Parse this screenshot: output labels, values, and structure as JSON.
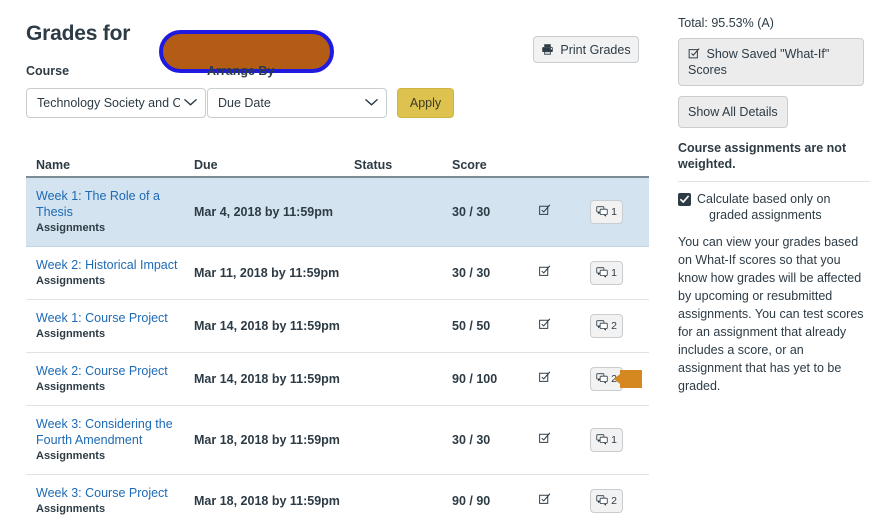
{
  "header": {
    "title": "Grades for",
    "redacted_name": "",
    "print_button": "Print Grades",
    "print_icon": "printer-icon"
  },
  "filters": {
    "course_label": "Course",
    "course_value": "Technology Society and Cu",
    "arrange_label": "Arrange By",
    "arrange_value": "Due Date",
    "apply_label": "Apply",
    "caret_icon": "chevron-down-icon"
  },
  "table": {
    "columns": [
      "Name",
      "Due",
      "Status",
      "Score",
      "",
      ""
    ],
    "rows": [
      {
        "name": "Week 1: The Role of a Thesis",
        "group": "Assignments",
        "due": "Mar 4, 2018 by 11:59pm",
        "status": "",
        "score": "30 / 30",
        "whatif_icon": "what-if-score-icon",
        "comment_icon": "comment-icon",
        "comment_count": "1",
        "highlighted": true,
        "marker": false
      },
      {
        "name": "Week 2: Historical Impact",
        "group": "Assignments",
        "due": "Mar 11, 2018 by 11:59pm",
        "status": "",
        "score": "30 / 30",
        "whatif_icon": "what-if-score-icon",
        "comment_icon": "comment-icon",
        "comment_count": "1",
        "highlighted": false,
        "marker": false
      },
      {
        "name": "Week 1: Course Project",
        "group": "Assignments",
        "due": "Mar 14, 2018 by 11:59pm",
        "status": "",
        "score": "50 / 50",
        "whatif_icon": "what-if-score-icon",
        "comment_icon": "comment-icon",
        "comment_count": "2",
        "highlighted": false,
        "marker": false
      },
      {
        "name": "Week 2: Course Project",
        "group": "Assignments",
        "due": "Mar 14, 2018 by 11:59pm",
        "status": "",
        "score": "90 / 100",
        "whatif_icon": "what-if-score-icon",
        "comment_icon": "comment-icon",
        "comment_count": "2",
        "highlighted": false,
        "marker": true
      },
      {
        "name": "Week 3: Considering the Fourth Amendment",
        "group": "Assignments",
        "due": "Mar 18, 2018 by 11:59pm",
        "status": "",
        "score": "30 / 30",
        "whatif_icon": "what-if-score-icon",
        "comment_icon": "comment-icon",
        "comment_count": "1",
        "highlighted": false,
        "marker": false
      },
      {
        "name": "Week 3: Course Project",
        "group": "Assignments",
        "due": "Mar 18, 2018 by 11:59pm",
        "status": "",
        "score": "90 / 90",
        "whatif_icon": "what-if-score-icon",
        "comment_icon": "comment-icon",
        "comment_count": "2",
        "highlighted": false,
        "marker": false
      }
    ]
  },
  "sidebar": {
    "total": "Total: 95.53% (A)",
    "show_saved_whatif": "Show Saved \"What-If\" Scores",
    "show_saved_whatif_icon": "what-if-score-icon",
    "show_all_details": "Show All Details",
    "weighting_note": "Course assignments are not weighted.",
    "checkbox_checked": true,
    "checkbox_label_line1": "Calculate based only on",
    "checkbox_label_line2": "graded assignments",
    "help_text": "You can view your grades based on What-If scores so that you know how grades will be affected by upcoming or resubmitted assignments. You can test scores for an assignment that already includes a score, or an assignment that has yet to be graded."
  },
  "colors": {
    "link": "#1d6ab5",
    "row_highlight": "#d3e3ef",
    "apply_button": "#ddc24f",
    "redaction_fill": "#b35c15",
    "redaction_border": "#2019e0",
    "marker": "#d4881f",
    "text": "#2d3b45"
  }
}
